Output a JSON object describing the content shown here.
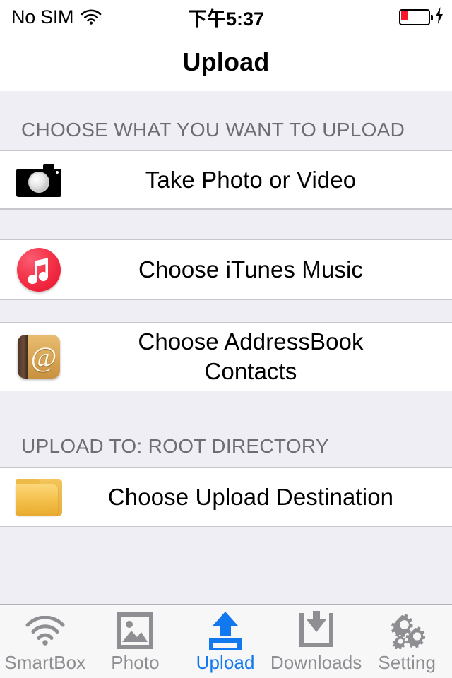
{
  "status_bar": {
    "carrier": "No SIM",
    "wifi_icon": "wifi-icon",
    "time": "下午5:37",
    "battery_icon": "battery-low-icon",
    "charging_icon": "lightning-bolt-icon",
    "battery_level_percent": 15,
    "battery_color": "#f5192b"
  },
  "navbar": {
    "title": "Upload"
  },
  "sections": [
    {
      "header": "CHOOSE WHAT YOU WANT TO UPLOAD",
      "rows": [
        {
          "icon": "camera-icon",
          "label": "Take Photo or Video",
          "label_line2": ""
        },
        {
          "icon": "itunes-music-icon",
          "label": "Choose iTunes Music",
          "label_line2": ""
        },
        {
          "icon": "addressbook-icon",
          "label": "Choose AddressBook",
          "label_line2": "Contacts"
        }
      ]
    },
    {
      "header": "UPLOAD TO: ROOT DIRECTORY",
      "rows": [
        {
          "icon": "folder-icon",
          "label": "Choose Upload Destination",
          "label_line2": ""
        }
      ]
    }
  ],
  "tabbar": {
    "active_color": "#1178ef",
    "inactive_color": "#8e8e93",
    "items": [
      {
        "icon": "wifi-icon",
        "label": "SmartBox",
        "active": false
      },
      {
        "icon": "photo-icon",
        "label": "Photo",
        "active": false
      },
      {
        "icon": "upload-arrow-icon",
        "label": "Upload",
        "active": true
      },
      {
        "icon": "download-tray-icon",
        "label": "Downloads",
        "active": false
      },
      {
        "icon": "gears-icon",
        "label": "Setting",
        "active": false
      }
    ]
  },
  "colors": {
    "group_background": "#eeeef4",
    "separator": "#c8c7cc",
    "header_text": "#6d6d72",
    "row_text": "#000000"
  }
}
